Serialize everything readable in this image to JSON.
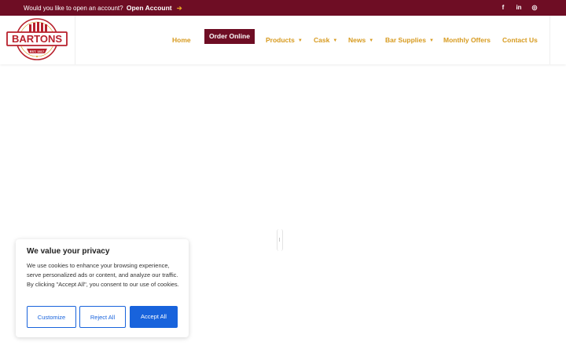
{
  "topbar": {
    "promo_text": "Would you like to open an account?",
    "promo_link": "Open Account",
    "promo_arrow": "➔",
    "social": [
      {
        "icon": "facebook-icon",
        "glyph": "f"
      },
      {
        "icon": "linkedin-icon",
        "glyph": "in"
      },
      {
        "icon": "instagram-icon",
        "glyph": "◎"
      }
    ]
  },
  "logo": {
    "name": "BARTONS",
    "tagline": "WHOLESALE WINE SPIRITS",
    "est": "EST. 1817",
    "colors": {
      "primary": "#b8202c",
      "accent": "#d79a1e"
    }
  },
  "nav": {
    "items": [
      {
        "label": "Home",
        "dropdown": false
      },
      {
        "label": "Order Online",
        "dropdown": false,
        "active": true
      },
      {
        "label": "Products",
        "dropdown": true
      },
      {
        "label": "Cask",
        "dropdown": true
      },
      {
        "label": "News",
        "dropdown": true
      },
      {
        "label": "Bar Supplies",
        "dropdown": true
      },
      {
        "label": "Monthly Offers",
        "dropdown": false
      },
      {
        "label": "Contact Us",
        "dropdown": false
      }
    ],
    "caret": "▼"
  },
  "cookie": {
    "title": "We value your privacy",
    "description": "We use cookies to enhance your browsing experience, serve personalized ads or content, and analyze our traffic. By clicking \"Accept All\", you consent to our use of cookies.",
    "buttons": {
      "customize": "Customize",
      "reject": "Reject All",
      "accept": "Accept All"
    }
  },
  "colors": {
    "brand": "#6e0d24",
    "nav_text": "#d79a1e",
    "cookie_accent": "#1863dc"
  }
}
